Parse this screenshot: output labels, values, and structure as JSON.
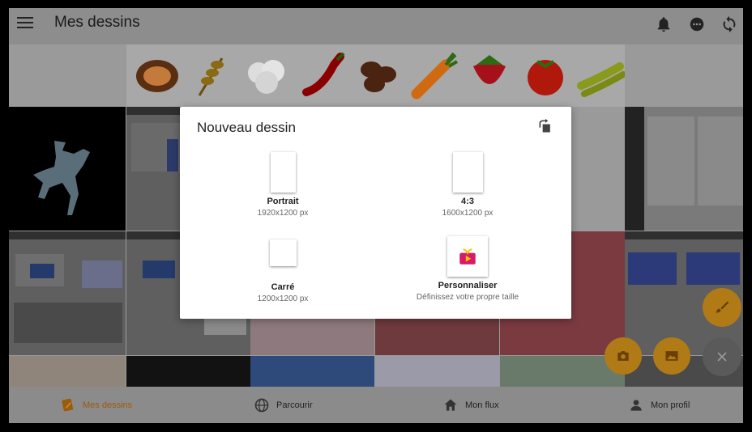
{
  "app": {
    "title": "Mes dessins"
  },
  "topbar_icons": [
    "menu-icon",
    "bell-icon",
    "chat-icon",
    "sync-icon"
  ],
  "dialog": {
    "title": "Nouveau dessin",
    "rotate_icon": "rotate-icon",
    "options": [
      {
        "label": "Portrait",
        "sub": "1920x1200 px"
      },
      {
        "label": "4:3",
        "sub": "1600x1200 px"
      },
      {
        "label": "Carré",
        "sub": "1200x1200 px"
      },
      {
        "label": "Personnaliser",
        "sub": "Définissez votre propre taille"
      }
    ]
  },
  "bottom_nav": [
    {
      "label": "Mes dessins",
      "icon": "drawings-icon",
      "active": true
    },
    {
      "label": "Parcourir",
      "icon": "globe-icon",
      "active": false
    },
    {
      "label": "Mon flux",
      "icon": "home-icon",
      "active": false
    },
    {
      "label": "Mon profil",
      "icon": "person-icon",
      "active": false
    }
  ],
  "fabs": [
    "brush-icon",
    "camera-icon",
    "image-icon",
    "close-icon"
  ],
  "colors": {
    "accent": "#f0a020",
    "active_nav": "#9c5a0a",
    "gift_pink": "#d61a6a"
  }
}
